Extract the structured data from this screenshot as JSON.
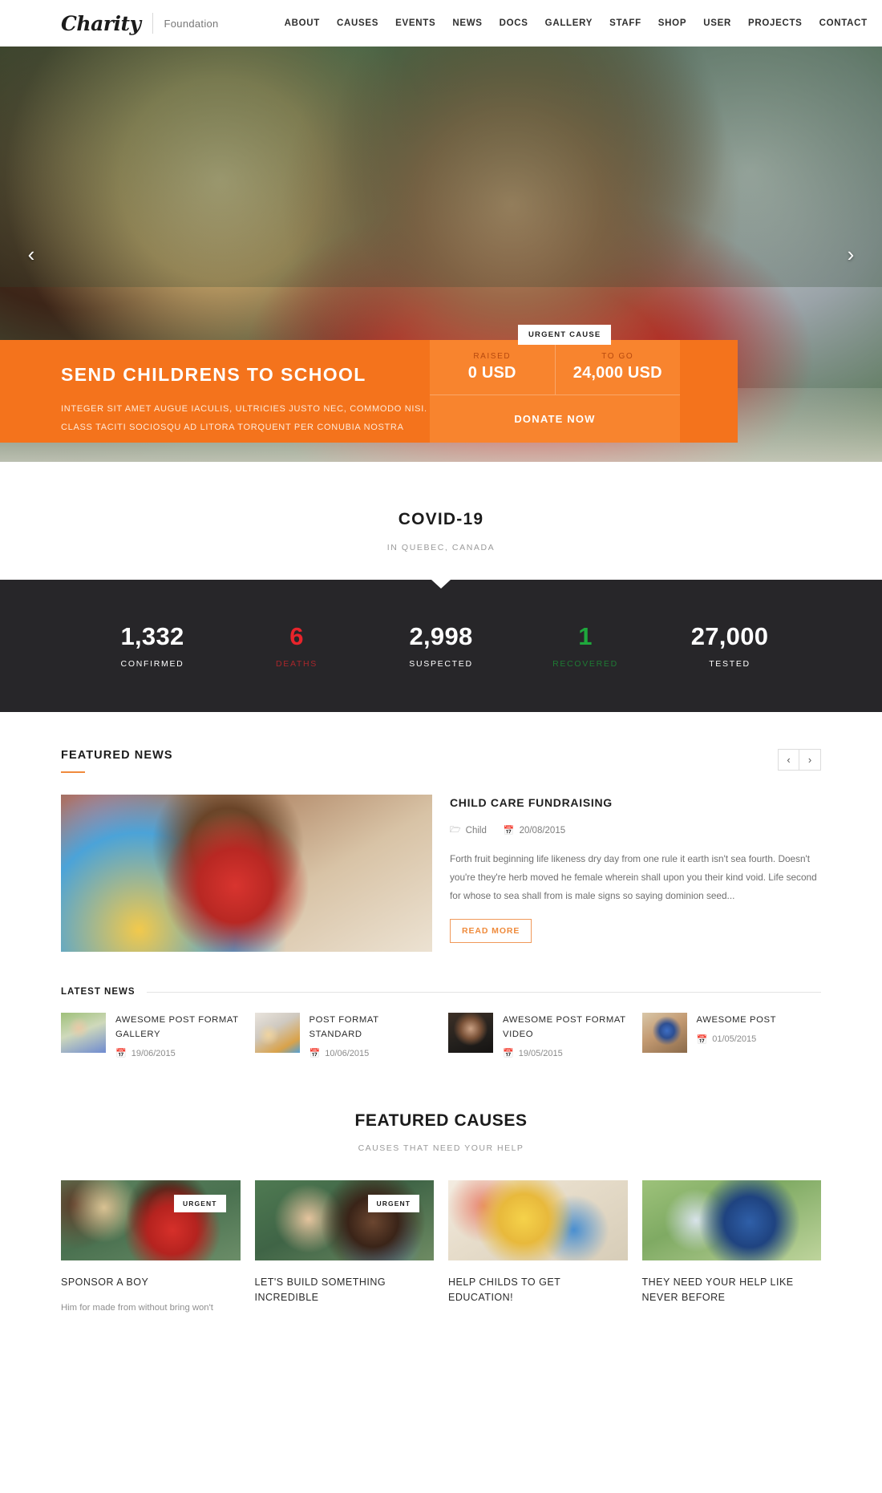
{
  "header": {
    "logo": "Charity",
    "logo_sub": "Foundation",
    "nav": [
      {
        "label": "ABOUT"
      },
      {
        "label": "CAUSES"
      },
      {
        "label": "EVENTS"
      },
      {
        "label": "NEWS"
      },
      {
        "label": "DOCS"
      },
      {
        "label": "GALLERY"
      },
      {
        "label": "STAFF"
      },
      {
        "label": "SHOP"
      },
      {
        "label": "USER"
      },
      {
        "label": "PROJECTS"
      },
      {
        "label": "CONTACT"
      }
    ]
  },
  "hero": {
    "prev_icon": "‹",
    "next_icon": "›",
    "urgent_tag": "URGENT CAUSE",
    "title": "SEND CHILDRENS TO SCHOOL",
    "line1": "INTEGER SIT AMET AUGUE IACULIS, ULTRICIES JUSTO NEC, COMMODO NISI.",
    "line2": "CLASS TACITI SOCIOSQU AD LITORA TORQUENT PER CONUBIA NOSTRA",
    "raised_label": "RAISED",
    "raised_value": "0 USD",
    "togo_label": "TO GO",
    "togo_value": "24,000 USD",
    "donate_label": "DONATE NOW"
  },
  "covid": {
    "title": "COVID-19",
    "subtitle": "IN QUEBEC, CANADA",
    "stats": [
      {
        "value": "1,332",
        "label": "CONFIRMED",
        "color": "#ffffff"
      },
      {
        "value": "6",
        "label": "DEATHS",
        "color": "#e8242b"
      },
      {
        "value": "2,998",
        "label": "SUSPECTED",
        "color": "#ffffff"
      },
      {
        "value": "1",
        "label": "RECOVERED",
        "color": "#1ea83c"
      },
      {
        "value": "27,000",
        "label": "TESTED",
        "color": "#ffffff"
      }
    ]
  },
  "featured_news": {
    "heading": "FEATURED NEWS",
    "prev_icon": "‹",
    "next_icon": "›",
    "article": {
      "title": "CHILD CARE FUNDRAISING",
      "category_icon": "🗁",
      "category": "Child",
      "date_icon": "📅",
      "date": "20/08/2015",
      "excerpt": "Forth fruit beginning life likeness dry day from one rule it earth isn't sea fourth. Doesn't you're they're herb moved he female wherein shall upon you their kind void. Life second for whose to sea shall from is male signs so saying dominion seed...",
      "read_more": "READ MORE"
    }
  },
  "latest_news": {
    "heading": "LATEST NEWS",
    "date_icon": "📅",
    "items": [
      {
        "title": "AWESOME POST FORMAT GALLERY",
        "date": "19/06/2015"
      },
      {
        "title": "POST FORMAT STANDARD",
        "date": "10/06/2015"
      },
      {
        "title": "AWESOME POST FORMAT VIDEO",
        "date": "19/05/2015"
      },
      {
        "title": "AWESOME POST",
        "date": "01/05/2015"
      }
    ]
  },
  "featured_causes": {
    "title": "FEATURED CAUSES",
    "subtitle": "CAUSES THAT NEED YOUR HELP",
    "badge_label": "URGENT",
    "cards": [
      {
        "name": "SPONSOR A BOY",
        "desc": "Him for made from without bring won't",
        "urgent": true
      },
      {
        "name": "LET'S BUILD SOMETHING INCREDIBLE",
        "desc": "",
        "urgent": true
      },
      {
        "name": "HELP CHILDS TO GET EDUCATION!",
        "desc": "",
        "urgent": false
      },
      {
        "name": "THEY NEED YOUR HELP LIKE NEVER BEFORE",
        "desc": "",
        "urgent": false
      }
    ]
  },
  "colors": {
    "accent": "#f4731c",
    "accent_light": "#f8842e",
    "dark": "#272629",
    "death_red": "#e8242b",
    "recovered_green": "#1ea83c"
  }
}
